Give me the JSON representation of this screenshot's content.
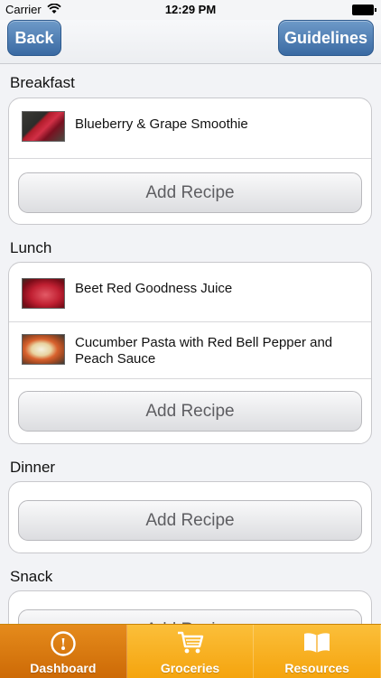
{
  "status_bar": {
    "carrier": "Carrier",
    "time": "12:29 PM"
  },
  "nav": {
    "back_label": "Back",
    "guidelines_label": "Guidelines"
  },
  "sections": {
    "breakfast": {
      "title": "Breakfast",
      "recipes": [
        "Blueberry & Grape Smoothie"
      ],
      "add_label": "Add Recipe"
    },
    "lunch": {
      "title": "Lunch",
      "recipes": [
        "Beet Red Goodness Juice",
        "Cucumber Pasta with Red Bell Pepper and Peach Sauce"
      ],
      "add_label": "Add Recipe"
    },
    "dinner": {
      "title": "Dinner",
      "recipes": [],
      "add_label": "Add Recipe"
    },
    "snack": {
      "title": "Snack",
      "recipes": [],
      "add_label": "Add Recipe"
    }
  },
  "tabs": [
    {
      "label": "Dashboard",
      "icon": "dashboard-icon",
      "active": true
    },
    {
      "label": "Groceries",
      "icon": "cart-icon",
      "active": false
    },
    {
      "label": "Resources",
      "icon": "book-icon",
      "active": false
    }
  ],
  "colors": {
    "nav_button": "#4a78b0",
    "tab_bar": "#f8b224",
    "tab_active": "#d9770f"
  }
}
